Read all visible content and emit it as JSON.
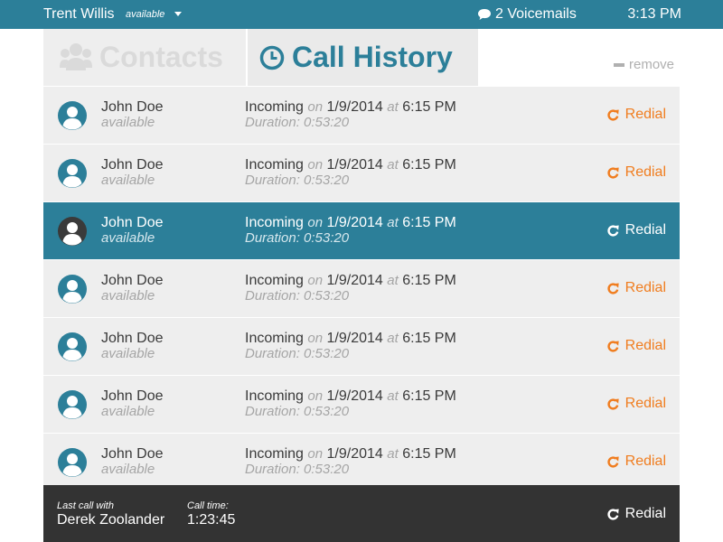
{
  "user": {
    "name": "Trent Willis",
    "status": "available"
  },
  "header": {
    "voicemails": "2 Voicemails",
    "time": "3:13 PM"
  },
  "tabs": [
    {
      "label": "Contacts",
      "icon": "users-icon",
      "active": false
    },
    {
      "label": "Call History",
      "icon": "clock-icon",
      "active": true
    }
  ],
  "remove_label": "remove",
  "labels": {
    "on": "on",
    "at": "at",
    "duration_prefix": "Duration: "
  },
  "calls": [
    {
      "name": "John Doe",
      "presence": "available",
      "direction": "Incoming",
      "date": "1/9/2014",
      "time": "6:15 PM",
      "duration": "0:53:20",
      "action": "Redial",
      "selected": false
    },
    {
      "name": "John Doe",
      "presence": "available",
      "direction": "Incoming",
      "date": "1/9/2014",
      "time": "6:15 PM",
      "duration": "0:53:20",
      "action": "Redial",
      "selected": false
    },
    {
      "name": "John Doe",
      "presence": "available",
      "direction": "Incoming",
      "date": "1/9/2014",
      "time": "6:15 PM",
      "duration": "0:53:20",
      "action": "Redial",
      "selected": true
    },
    {
      "name": "John Doe",
      "presence": "available",
      "direction": "Incoming",
      "date": "1/9/2014",
      "time": "6:15 PM",
      "duration": "0:53:20",
      "action": "Redial",
      "selected": false
    },
    {
      "name": "John Doe",
      "presence": "available",
      "direction": "Incoming",
      "date": "1/9/2014",
      "time": "6:15 PM",
      "duration": "0:53:20",
      "action": "Redial",
      "selected": false
    },
    {
      "name": "John Doe",
      "presence": "available",
      "direction": "Incoming",
      "date": "1/9/2014",
      "time": "6:15 PM",
      "duration": "0:53:20",
      "action": "Redial",
      "selected": false
    },
    {
      "name": "John Doe",
      "presence": "available",
      "direction": "Incoming",
      "date": "1/9/2014",
      "time": "6:15 PM",
      "duration": "0:53:20",
      "action": "Redial",
      "selected": false
    }
  ],
  "footer": {
    "last_call_caption": "Last call with",
    "last_call_name": "Derek Zoolander",
    "call_time_caption": "Call time:",
    "call_time": "1:23:45",
    "action": "Redial"
  },
  "colors": {
    "primary": "#2c7f99",
    "accent": "#f07d1f",
    "row_bg": "#eeeeee",
    "footer_bg": "#333333",
    "muted": "#a5a5a5"
  }
}
